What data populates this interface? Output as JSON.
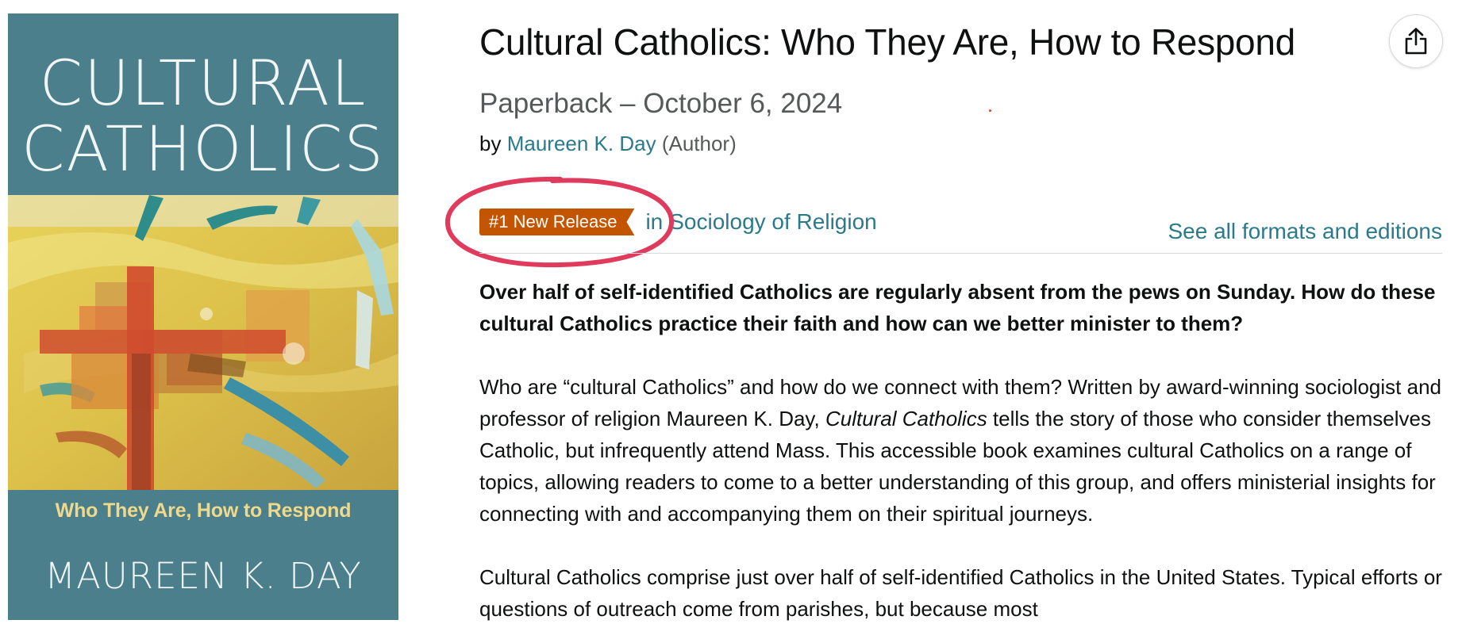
{
  "cover": {
    "title_line1": "CULTURAL",
    "title_line2": "CATHOLICS",
    "subtitle": "Who They Are, How to Respond",
    "author": "MAUREEN K. DAY",
    "background_color": "#4b7f8b",
    "subtitle_color": "#eed98c"
  },
  "product": {
    "title": "Cultural Catholics: Who They Are, How to Respond",
    "format_date": "Paperback – October 6, 2024",
    "by_label": "by",
    "author_name": "Maureen K. Day",
    "author_role": "(Author)",
    "share_icon": "share-icon"
  },
  "badge": {
    "label": "#1 New Release",
    "in_label": "in",
    "category": "Sociology of Religion",
    "color": "#c45500",
    "highlight_color": "#e03a5c"
  },
  "formats": {
    "see_all": "See all formats and editions"
  },
  "description": {
    "lead": "Over half of self-identified Catholics are regularly absent from the pews on Sunday. How do these cultural Catholics practice their faith and how can we better minister to them?",
    "p2_before": "Who are “cultural Catholics” and how do we connect with them? Written by award-winning sociologist and professor of religion Maureen K. Day, ",
    "p2_italic": "Cultural Catholics",
    "p2_after": " tells the story of those who consider themselves Catholic, but infrequently attend Mass. This accessible book examines cultural Catholics on a range of topics, allowing readers to come to a better understanding of this group, and offers ministerial insights for connecting with and accompanying them on their spiritual journeys.",
    "p3": "Cultural Catholics comprise just over half of self-identified Catholics in the United States. Typical efforts or questions of outreach come from parishes, but because most"
  },
  "colors": {
    "link": "#2b7a8b",
    "muted": "#565959",
    "text": "#0f1111"
  }
}
